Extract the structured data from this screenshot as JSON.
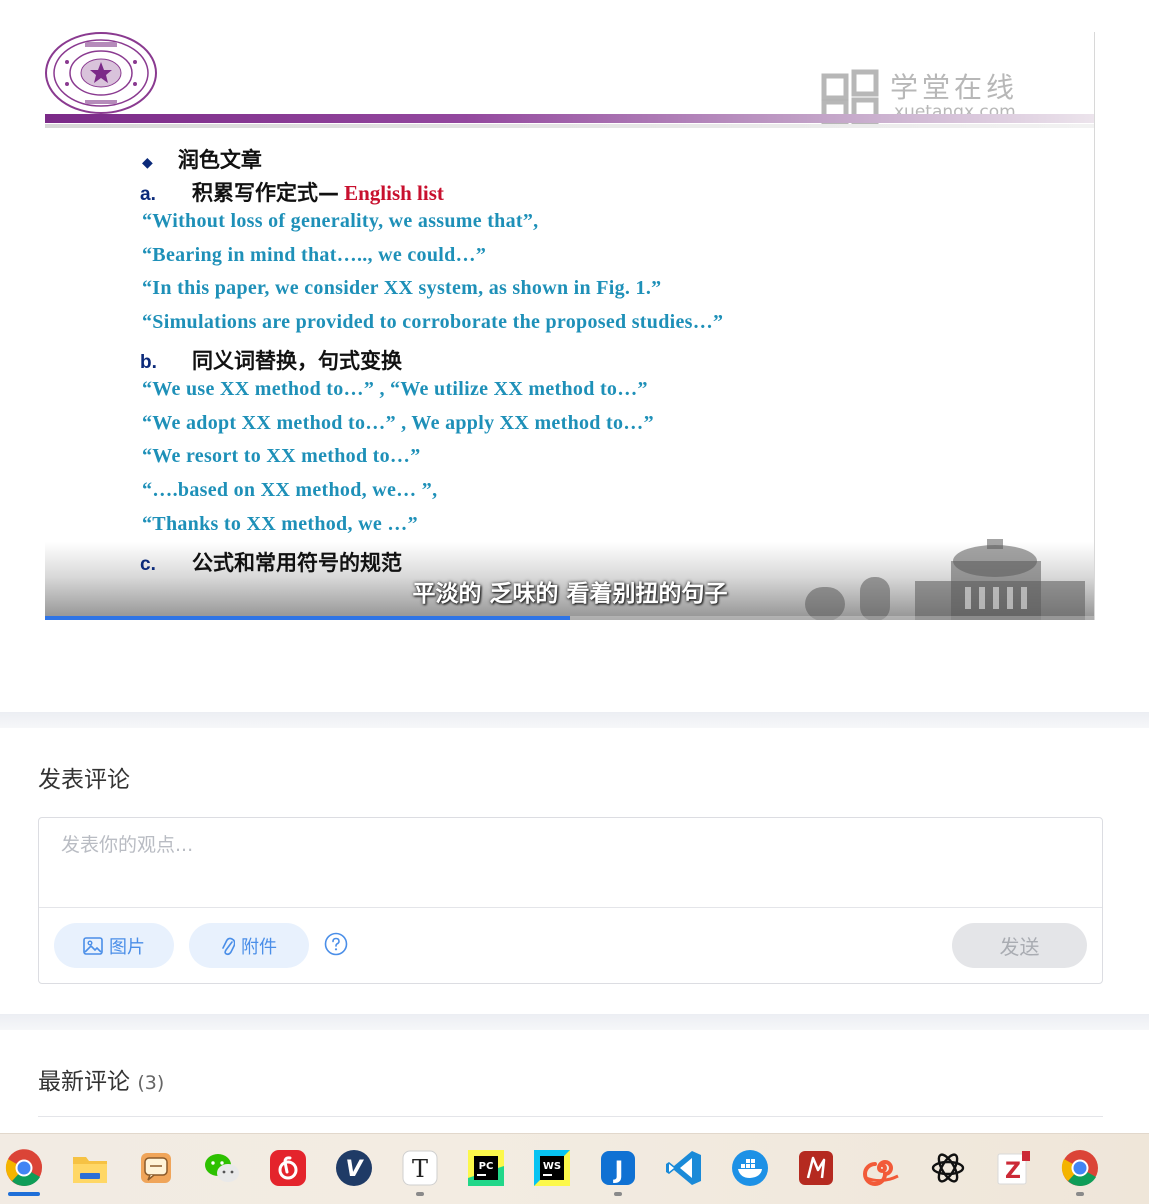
{
  "video": {
    "watermark": {
      "brand": "学堂在线",
      "url": "xuetangx.com"
    },
    "subtitle": "平淡的 乏味的 看着别扭的句子",
    "progress_fraction": 0.5,
    "slide": {
      "bullet": "◆",
      "heading": "润色文章",
      "section_a": {
        "letter": "a.",
        "title": "积累写作定式—",
        "title_en": "English list"
      },
      "section_a_lines": [
        "“Without loss of generality, we assume that”,",
        "“Bearing in mind that….., we could…”",
        "“In this paper, we consider XX system, as shown in Fig. 1.”",
        "“Simulations are provided to corroborate the proposed studies…”"
      ],
      "section_b": {
        "letter": "b.",
        "title": "同义词替换，句式变换"
      },
      "section_b_lines": [
        "“We use XX method to…” , “We utilize XX method to…”",
        "“We adopt XX method to…” , We apply XX method to…”",
        "“We resort to XX method to…”",
        "“….based on XX method, we… ”,",
        "“Thanks to XX method, we …”"
      ],
      "section_c": {
        "letter": "c.",
        "title": "公式和常用符号的规范"
      }
    }
  },
  "composer": {
    "title": "发表评论",
    "placeholder": "发表你的观点...",
    "image_label": "图片",
    "attach_label": "附件",
    "send_label": "发送"
  },
  "comments": {
    "title": "最新评论",
    "count": "(3)"
  },
  "taskbar": {
    "items": [
      {
        "name": "chrome-icon",
        "glyph": ""
      },
      {
        "name": "file-explorer-icon",
        "glyph": ""
      },
      {
        "name": "chat-app-icon",
        "glyph": ""
      },
      {
        "name": "wechat-icon",
        "glyph": ""
      },
      {
        "name": "netease-music-icon",
        "glyph": ""
      },
      {
        "name": "vivaldi-icon",
        "glyph": "V"
      },
      {
        "name": "typora-icon",
        "glyph": "T"
      },
      {
        "name": "pycharm-icon",
        "glyph": "PC"
      },
      {
        "name": "webstorm-icon",
        "glyph": "WS"
      },
      {
        "name": "joplin-icon",
        "glyph": "J"
      },
      {
        "name": "vscode-icon",
        "glyph": ""
      },
      {
        "name": "docker-icon",
        "glyph": ""
      },
      {
        "name": "red-app-icon",
        "glyph": ""
      },
      {
        "name": "snail-app-icon",
        "glyph": ""
      },
      {
        "name": "chatgpt-icon",
        "glyph": ""
      },
      {
        "name": "zotero-icon",
        "glyph": "Z"
      },
      {
        "name": "chrome-icon-2",
        "glyph": ""
      }
    ],
    "colors": {
      "active_indicator": "#1f6fd8",
      "accent_blue": "#4a8ee8"
    }
  }
}
